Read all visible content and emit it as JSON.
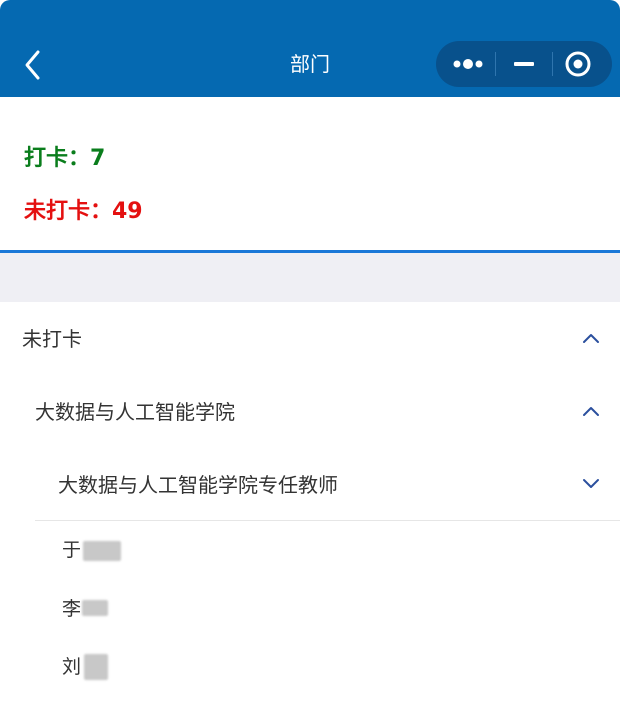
{
  "navbar": {
    "title": "部门",
    "bg_color": "#0569b1",
    "back_icon": "chevron-left-icon",
    "capsule_icons": [
      "more-dots-icon",
      "minimize-icon",
      "target-close-icon"
    ]
  },
  "stats": {
    "checked_text": "打卡：7",
    "checked_color": "#0a7d1c",
    "unchecked_text": "未打卡：49",
    "unchecked_color": "#e41010"
  },
  "tree": {
    "level1_label": "未打卡",
    "level2_label": "大数据与人工智能学院",
    "level3_label": "大数据与人工智能学院专任教师",
    "people": [
      "于",
      "李",
      "刘"
    ]
  }
}
